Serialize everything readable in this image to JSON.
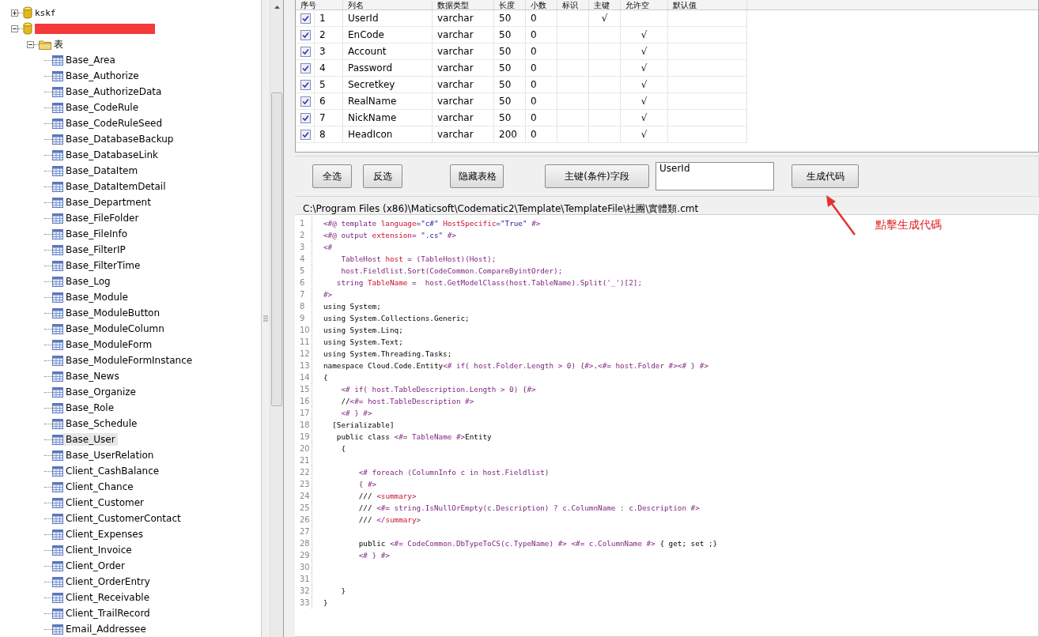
{
  "tree": [
    {
      "label": "kskf",
      "kind": "database",
      "expanded": false
    },
    {
      "kind": "database",
      "redacted": true,
      "expanded": true,
      "children": [
        {
          "label": "表",
          "kind": "folder",
          "expanded": true,
          "children": [
            {
              "label": "Base_Area",
              "kind": "table",
              "selected": false
            },
            {
              "label": "Base_Authorize",
              "kind": "table",
              "selected": false
            },
            {
              "label": "Base_AuthorizeData",
              "kind": "table",
              "selected": false
            },
            {
              "label": "Base_CodeRule",
              "kind": "table",
              "selected": false
            },
            {
              "label": "Base_CodeRuleSeed",
              "kind": "table",
              "selected": false
            },
            {
              "label": "Base_DatabaseBackup",
              "kind": "table",
              "selected": false
            },
            {
              "label": "Base_DatabaseLink",
              "kind": "table",
              "selected": false
            },
            {
              "label": "Base_DataItem",
              "kind": "table",
              "selected": false
            },
            {
              "label": "Base_DataItemDetail",
              "kind": "table",
              "selected": false
            },
            {
              "label": "Base_Department",
              "kind": "table",
              "selected": false
            },
            {
              "label": "Base_FileFolder",
              "kind": "table",
              "selected": false
            },
            {
              "label": "Base_FileInfo",
              "kind": "table",
              "selected": false
            },
            {
              "label": "Base_FilterIP",
              "kind": "table",
              "selected": false
            },
            {
              "label": "Base_FilterTime",
              "kind": "table",
              "selected": false
            },
            {
              "label": "Base_Log",
              "kind": "table",
              "selected": false
            },
            {
              "label": "Base_Module",
              "kind": "table",
              "selected": false
            },
            {
              "label": "Base_ModuleButton",
              "kind": "table",
              "selected": false
            },
            {
              "label": "Base_ModuleColumn",
              "kind": "table",
              "selected": false
            },
            {
              "label": "Base_ModuleForm",
              "kind": "table",
              "selected": false
            },
            {
              "label": "Base_ModuleFormInstance",
              "kind": "table",
              "selected": false
            },
            {
              "label": "Base_News",
              "kind": "table",
              "selected": false
            },
            {
              "label": "Base_Organize",
              "kind": "table",
              "selected": false
            },
            {
              "label": "Base_Role",
              "kind": "table",
              "selected": false
            },
            {
              "label": "Base_Schedule",
              "kind": "table",
              "selected": false
            },
            {
              "label": "Base_User",
              "kind": "table",
              "selected": true
            },
            {
              "label": "Base_UserRelation",
              "kind": "table",
              "selected": false
            },
            {
              "label": "Client_CashBalance",
              "kind": "table",
              "selected": false
            },
            {
              "label": "Client_Chance",
              "kind": "table",
              "selected": false
            },
            {
              "label": "Client_Customer",
              "kind": "table",
              "selected": false
            },
            {
              "label": "Client_CustomerContact",
              "kind": "table",
              "selected": false
            },
            {
              "label": "Client_Expenses",
              "kind": "table",
              "selected": false
            },
            {
              "label": "Client_Invoice",
              "kind": "table",
              "selected": false
            },
            {
              "label": "Client_Order",
              "kind": "table",
              "selected": false
            },
            {
              "label": "Client_OrderEntry",
              "kind": "table",
              "selected": false
            },
            {
              "label": "Client_Receivable",
              "kind": "table",
              "selected": false
            },
            {
              "label": "Client_TrailRecord",
              "kind": "table",
              "selected": false
            },
            {
              "label": "Email_Addressee",
              "kind": "table",
              "selected": false
            }
          ]
        }
      ]
    }
  ],
  "table": {
    "columns": [
      "序号",
      "列名",
      "数据类型",
      "长度",
      "小数",
      "标识",
      "主键",
      "允许空",
      "默认值"
    ],
    "rows": [
      {
        "checked": true,
        "cells": [
          "1",
          "UserId",
          "varchar",
          "50",
          "0",
          "",
          "√",
          "",
          ""
        ]
      },
      {
        "checked": true,
        "cells": [
          "2",
          "EnCode",
          "varchar",
          "50",
          "0",
          "",
          "",
          "√",
          ""
        ]
      },
      {
        "checked": true,
        "cells": [
          "3",
          "Account",
          "varchar",
          "50",
          "0",
          "",
          "",
          "√",
          ""
        ]
      },
      {
        "checked": true,
        "cells": [
          "4",
          "Password",
          "varchar",
          "50",
          "0",
          "",
          "",
          "√",
          ""
        ]
      },
      {
        "checked": true,
        "cells": [
          "5",
          "Secretkey",
          "varchar",
          "50",
          "0",
          "",
          "",
          "√",
          ""
        ]
      },
      {
        "checked": true,
        "cells": [
          "6",
          "RealName",
          "varchar",
          "50",
          "0",
          "",
          "",
          "√",
          ""
        ]
      },
      {
        "checked": true,
        "cells": [
          "7",
          "NickName",
          "varchar",
          "50",
          "0",
          "",
          "",
          "√",
          ""
        ]
      },
      {
        "checked": true,
        "cells": [
          "8",
          "HeadIcon",
          "varchar",
          "200",
          "0",
          "",
          "",
          "√",
          ""
        ]
      }
    ]
  },
  "toolbar": {
    "buttons": [
      "全选",
      "反选",
      "隐藏表格",
      "主键(条件)字段"
    ],
    "key_field": "UserId",
    "generate_button": "生成代码"
  },
  "template_path": "C:\\Program Files (x86)\\Maticsoft\\Codematic2\\Template\\TemplateFile\\社團\\實體類.cmt",
  "code_lines": [
    {
      "number": "1",
      "segments": [
        {
          "kind": "directive",
          "text": "<#@ template "
        },
        {
          "kind": "attribute",
          "text": "language"
        },
        {
          "kind": "directive",
          "text": "="
        },
        {
          "kind": "string",
          "text": "\"c#\" "
        },
        {
          "kind": "attribute",
          "text": "HostSpecific"
        },
        {
          "kind": "directive",
          "text": "="
        },
        {
          "kind": "string",
          "text": "\"True\""
        },
        {
          "kind": "directive",
          "text": " #>"
        }
      ]
    },
    {
      "number": "2",
      "segments": [
        {
          "kind": "directive",
          "text": "<#@ output "
        },
        {
          "kind": "attribute",
          "text": "extension"
        },
        {
          "kind": "directive",
          "text": "= "
        },
        {
          "kind": "string",
          "text": "\".cs\""
        },
        {
          "kind": "directive",
          "text": " #>"
        }
      ]
    },
    {
      "number": "3",
      "segments": [
        {
          "kind": "directive",
          "text": "<#"
        }
      ]
    },
    {
      "number": "4",
      "segments": [
        {
          "kind": "directive",
          "text": "    TableHost "
        },
        {
          "kind": "attribute",
          "text": "host"
        },
        {
          "kind": "directive",
          "text": " = (TableHost)(Host);"
        }
      ]
    },
    {
      "number": "5",
      "segments": [
        {
          "kind": "directive",
          "text": "    host.Fieldlist.Sort(CodeCommon.CompareByintOrder);"
        }
      ]
    },
    {
      "number": "6",
      "segments": [
        {
          "kind": "directive",
          "text": "   string "
        },
        {
          "kind": "attribute",
          "text": "TableName"
        },
        {
          "kind": "directive",
          "text": " =  host.GetModelClass(host.TableName).Split('_')[2];"
        }
      ]
    },
    {
      "number": "7",
      "segments": [
        {
          "kind": "directive",
          "text": "#>"
        }
      ]
    },
    {
      "number": "8",
      "segments": [
        {
          "kind": "plain",
          "text": "using System;"
        }
      ]
    },
    {
      "number": "9",
      "segments": [
        {
          "kind": "plain",
          "text": "using System.Collections.Generic;"
        }
      ]
    },
    {
      "number": "10",
      "segments": [
        {
          "kind": "plain",
          "text": "using System.Linq;"
        }
      ]
    },
    {
      "number": "11",
      "segments": [
        {
          "kind": "plain",
          "text": "using System.Text;"
        }
      ]
    },
    {
      "number": "12",
      "segments": [
        {
          "kind": "plain",
          "text": "using System.Threading.Tasks;"
        }
      ]
    },
    {
      "number": "13",
      "segments": [
        {
          "kind": "plain",
          "text": "namespace Cloud.Code.Entity"
        },
        {
          "kind": "directive",
          "text": "<# if( host.Folder.Length > 0) {#>"
        },
        {
          "kind": "plain",
          "text": "."
        },
        {
          "kind": "directive",
          "text": "<#= host.Folder #><# } #>"
        }
      ]
    },
    {
      "number": "14",
      "segments": [
        {
          "kind": "plain",
          "text": "{"
        }
      ]
    },
    {
      "number": "15",
      "segments": [
        {
          "kind": "directive",
          "text": "    <# if( host.TableDescription.Length > 0) {#>"
        }
      ]
    },
    {
      "number": "16",
      "segments": [
        {
          "kind": "plain",
          "text": "    //"
        },
        {
          "kind": "directive",
          "text": "<#= host.TableDescription #>"
        }
      ]
    },
    {
      "number": "17",
      "segments": [
        {
          "kind": "directive",
          "text": "    <# } #>"
        }
      ]
    },
    {
      "number": "18",
      "segments": [
        {
          "kind": "plain",
          "text": "  [Serializable]"
        }
      ]
    },
    {
      "number": "19",
      "segments": [
        {
          "kind": "plain",
          "text": "   public class "
        },
        {
          "kind": "directive",
          "text": "<#= TableName #>"
        },
        {
          "kind": "plain",
          "text": "Entity"
        }
      ]
    },
    {
      "number": "20",
      "segments": [
        {
          "kind": "plain",
          "text": "    {"
        }
      ]
    },
    {
      "number": "21"
    },
    {
      "number": "22",
      "segments": [
        {
          "kind": "directive",
          "text": "        <# foreach (ColumnInfo c in host.Fieldlist)"
        }
      ]
    },
    {
      "number": "23",
      "segments": [
        {
          "kind": "directive",
          "text": "        { #>"
        }
      ]
    },
    {
      "number": "24",
      "segments": [
        {
          "kind": "plain",
          "text": "        /// "
        },
        {
          "kind": "directive",
          "text": "<"
        },
        {
          "kind": "attribute",
          "text": "summary"
        },
        {
          "kind": "directive",
          "text": ">"
        }
      ]
    },
    {
      "number": "25",
      "segments": [
        {
          "kind": "plain",
          "text": "        /// "
        },
        {
          "kind": "directive",
          "text": "<#= string.IsNullOrEmpty(c.Description) ? c.ColumnName : c.Description #>"
        }
      ]
    },
    {
      "number": "26",
      "segments": [
        {
          "kind": "plain",
          "text": "        /// "
        },
        {
          "kind": "directive",
          "text": "</"
        },
        {
          "kind": "attribute",
          "text": "summary"
        },
        {
          "kind": "directive",
          "text": ">"
        }
      ]
    },
    {
      "number": "27"
    },
    {
      "number": "28",
      "segments": [
        {
          "kind": "plain",
          "text": "        public "
        },
        {
          "kind": "directive",
          "text": "<#= CodeCommon.DbTypeToCS(c.TypeName) #> <#= c.ColumnName #>"
        },
        {
          "kind": "plain",
          "text": " { get; set ;}"
        }
      ]
    },
    {
      "number": "29",
      "segments": [
        {
          "kind": "directive",
          "text": "        <# } #>"
        }
      ]
    },
    {
      "number": "30"
    },
    {
      "number": "31"
    },
    {
      "number": "32",
      "segments": [
        {
          "kind": "plain",
          "text": "    }"
        }
      ]
    },
    {
      "number": "33",
      "segments": [
        {
          "kind": "plain",
          "text": "}"
        }
      ]
    }
  ],
  "annotation": "點擊生成代碼"
}
